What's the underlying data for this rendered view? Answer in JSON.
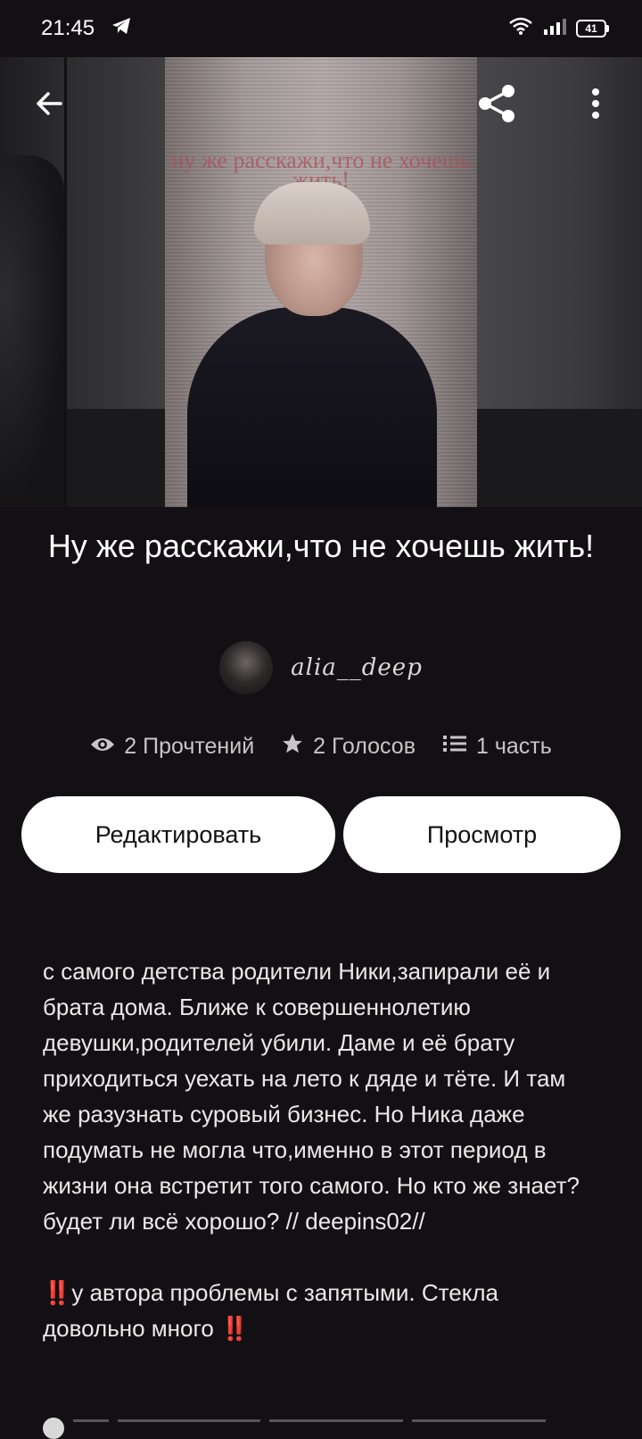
{
  "status_bar": {
    "time": "21:45",
    "battery": "41"
  },
  "cover": {
    "overlay_text": "ну же расскажи,что не хочешь жить!"
  },
  "story": {
    "title": "Ну же расскажи,что не хочешь жить!",
    "author": "alia__deep",
    "stats": {
      "reads": "2 Прочтений",
      "votes": "2 Голосов",
      "parts": "1 часть"
    }
  },
  "actions": {
    "edit": "Редактировать",
    "preview": "Просмотр"
  },
  "description": {
    "paragraph1": "с самого детства родители Ники,запирали её и брата дома. Ближе к совершеннолетию девушки,родителей убили. Даме и её брату приходиться уехать на лето к дяде и тёте.  И там же разузнать суровый бизнес. Но Ника даже подумать не могла что,именно в этот период в жизни она встретит того самого. Но кто же знает? будет ли всё хорошо? // deepins02//",
    "paragraph2_prefix": "‼️",
    "paragraph2": "у автора проблемы с запятыми. Стекла довольно много ",
    "paragraph2_suffix": "‼️"
  }
}
